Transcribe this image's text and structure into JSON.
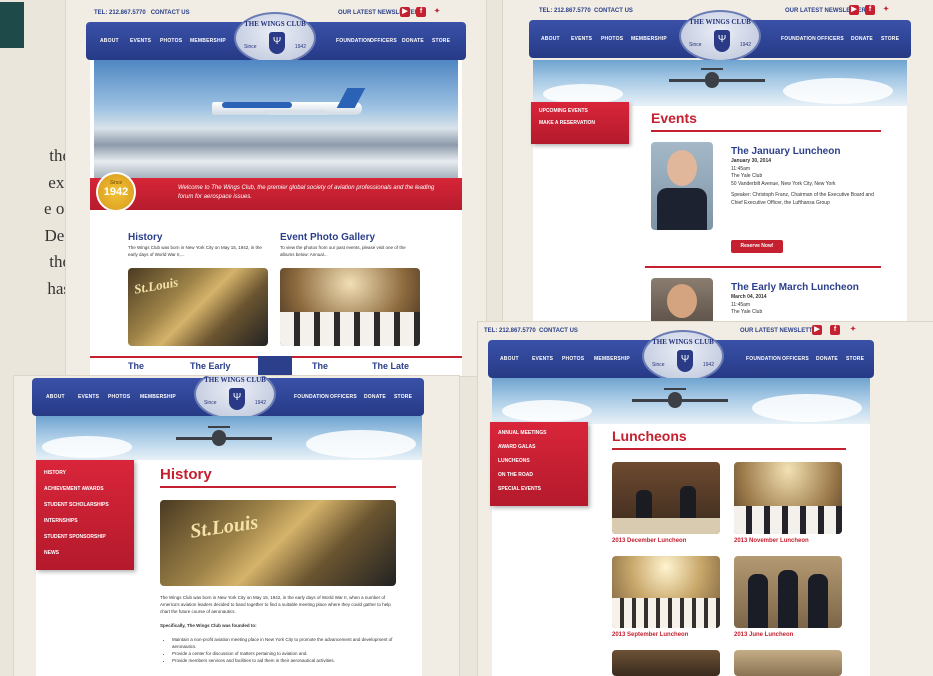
{
  "left_text": {
    "t": "T",
    "lines": [
      "the",
      "ex-",
      "e of",
      "De-",
      "the",
      "has"
    ]
  },
  "header": {
    "tel": "TEL: 212.867.5770",
    "contact": "CONTACT US",
    "newsletter": "OUR LATEST NEWSLETTER",
    "nav_left": [
      "ABOUT",
      "EVENTS",
      "PHOTOS",
      "MEMBERSHIP"
    ],
    "nav_right": [
      "FOUNDATION",
      "OFFICERS",
      "DONATE",
      "STORE"
    ],
    "logo": {
      "title": "THE WINGS CLUB",
      "since": "Since",
      "year": "1942"
    }
  },
  "home": {
    "badge_since": "Since",
    "badge_year": "1942",
    "banner": "Welcome to The Wings Club, the premier global society of aviation professionals and the leading forum for aerospace issues.",
    "history_title": "History",
    "history_text": "The Wings Club was born in New York City on May 15, 1942, in the early days of World War II,...",
    "gallery_title": "Event Photo Gallery",
    "gallery_text": "To view the photos from our past events, please visit one of the albums below: Annual...",
    "bottom_tabs": [
      "The",
      "The Early",
      "",
      "The",
      "The Late"
    ]
  },
  "events": {
    "sidebar": [
      "UPCOMING EVENTS",
      "MAKE A RESERVATION"
    ],
    "title": "Events",
    "e1": {
      "title": "The January Luncheon",
      "date": "January 30, 2014",
      "time": "11:45am",
      "venue": "The Yale Club",
      "address": "50 Vanderbilt Avenue, New York City, New York",
      "speaker": "Speaker: Christoph Franz, Chairman of the Executive Board and Chief Executive Officer, the Lufthansa Group",
      "button": "Reserve Now!"
    },
    "e2": {
      "title": "The Early March Luncheon",
      "date": "March 04, 2014",
      "time": "11:45am",
      "venue": "The Yale Club"
    }
  },
  "history_page": {
    "sidebar": [
      "HISTORY",
      "ACHIEVEMENT AWARDS",
      "STUDENT SCHOLARSHIPS",
      "INTERNSHIPS",
      "STUDENT SPONSORSHIP",
      "NEWS"
    ],
    "title": "History",
    "p1": "The Wings Club was born in New York City on May 15, 1942, in the early days of World War II, when a number of America's aviation leaders decided to band together to find a suitable meeting place where they could gather to help chart the future course of aeronautics.",
    "subhead": "Specifically, The Wings Club was founded to:",
    "bullets": [
      "Maintain a non-profit aviation meeting place in New York City to promote the advancement and development of aeronautics.",
      "Provide a center for discussion of matters pertaining to aviation and.",
      "Provide members services and facilities to aid them in their aeronautical activities."
    ]
  },
  "luncheons": {
    "sidebar": [
      "ANNUAL MEETINGS",
      "AWARD GALAS",
      "LUNCHEONS",
      "ON THE ROAD",
      "SPECIAL EVENTS"
    ],
    "title": "Luncheons",
    "captions": [
      "2013 December Luncheon",
      "2013 November Luncheon",
      "2013 September Luncheon",
      "2013 June Luncheon"
    ]
  },
  "colors": {
    "brand_blue": "#2b3f8a",
    "brand_red": "#c4202f",
    "background": "#ebe6dc"
  }
}
